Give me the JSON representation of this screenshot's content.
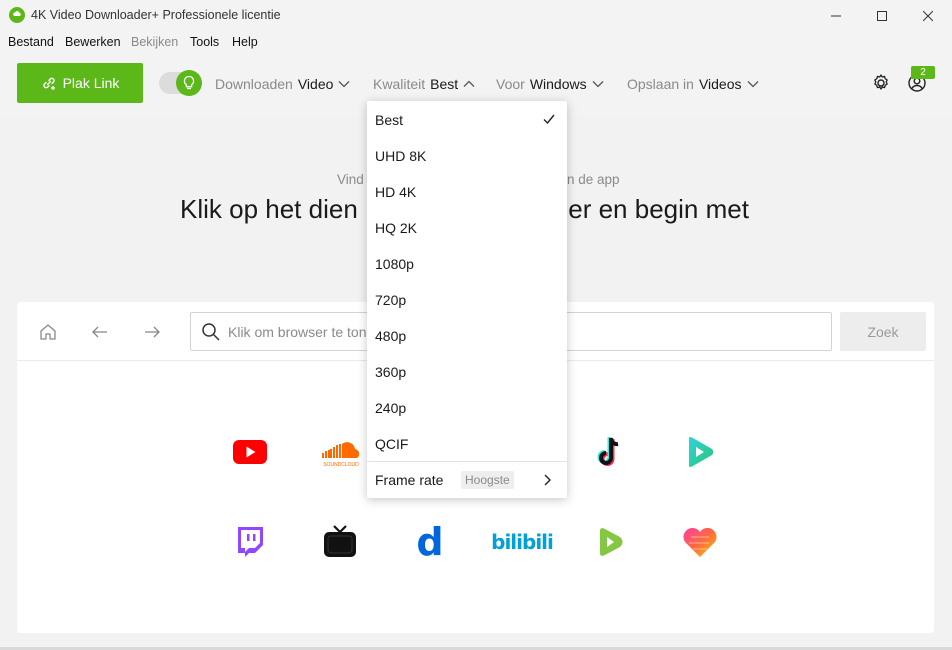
{
  "window": {
    "title": "4K Video Downloader+ Professionele licentie"
  },
  "menu": {
    "items": [
      "Bestand",
      "Bewerken",
      "Bekijken",
      "Tools",
      "Help"
    ]
  },
  "toolbar": {
    "paste_label": "Plak Link",
    "download_label": "Downloaden",
    "download_value": "Video",
    "quality_label": "Kwaliteit",
    "quality_value": "Best",
    "for_label": "Voor",
    "for_value": "Windows",
    "save_label": "Opslaan in",
    "save_value": "Videos",
    "notification_count": "2",
    "accent": "#5cb818"
  },
  "hero": {
    "subtitle_left": "Vind",
    "subtitle_right": "n de app",
    "title_left": "Klik op het dien",
    "title_right": "der en begin met"
  },
  "browser": {
    "search_placeholder": "Klik om browser te ton",
    "search_button": "Zoek",
    "sites": [
      "youtube-icon",
      "soundcloud-icon",
      "tiktok-icon",
      "play-icon",
      "twitch-icon",
      "tv-icon",
      "dailymotion-icon",
      "bilibili-icon",
      "rumble-icon",
      "likee-icon"
    ],
    "soundcloud_caption": "SOUNDCLOUD",
    "dailymotion_glyph": "d",
    "bilibili_text": "bilibili"
  },
  "quality_dropdown": {
    "options": [
      "Best",
      "UHD 8K",
      "HD 4K",
      "HQ 2K",
      "1080p",
      "720p",
      "480p",
      "360p",
      "240p",
      "QCIF"
    ],
    "selected": "Best",
    "frame_rate_label": "Frame rate",
    "frame_rate_value": "Hoogste"
  }
}
